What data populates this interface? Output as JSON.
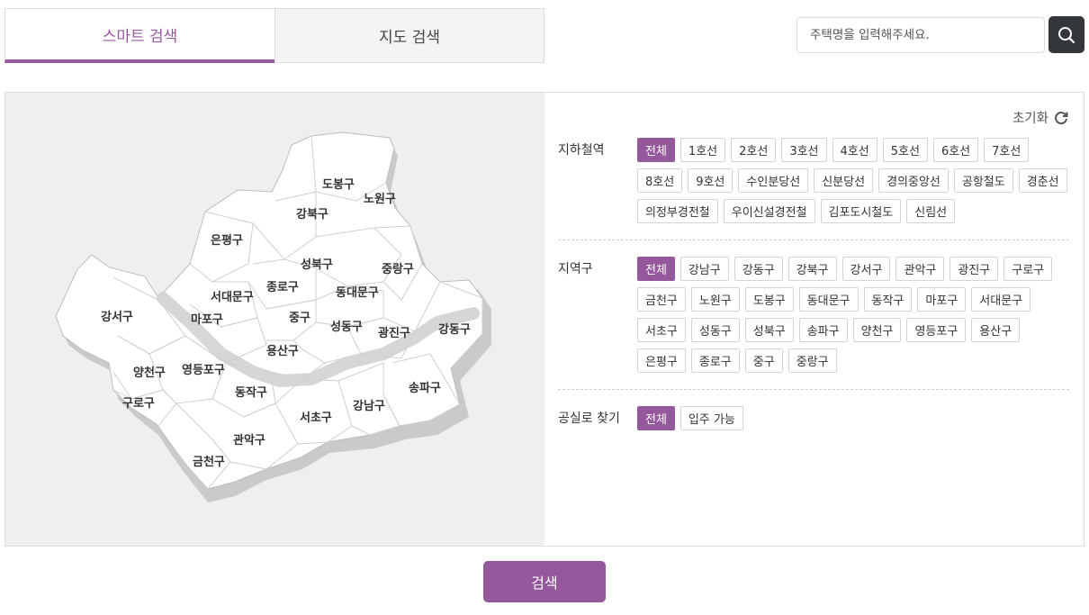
{
  "tabs": [
    {
      "label": "스마트 검색",
      "active": true
    },
    {
      "label": "지도 검색",
      "active": false
    }
  ],
  "search": {
    "placeholder": "주택명을 입력해주세요.",
    "icon": "search-icon"
  },
  "reset": {
    "label": "초기화",
    "icon": "refresh-icon"
  },
  "filters": {
    "subway": {
      "label": "지하철역",
      "options": [
        "전체",
        "1호선",
        "2호선",
        "3호선",
        "4호선",
        "5호선",
        "6호선",
        "7호선",
        "8호선",
        "9호선",
        "수인분당선",
        "신분당선",
        "경의중앙선",
        "공항철도",
        "경춘선",
        "의정부경전철",
        "우이신설경전철",
        "김포도시철도",
        "신림선"
      ],
      "selected": "전체"
    },
    "district": {
      "label": "지역구",
      "options": [
        "전체",
        "강남구",
        "강동구",
        "강북구",
        "강서구",
        "관악구",
        "광진구",
        "구로구",
        "금천구",
        "노원구",
        "도봉구",
        "동대문구",
        "동작구",
        "마포구",
        "서대문구",
        "서초구",
        "성동구",
        "성북구",
        "송파구",
        "양천구",
        "영등포구",
        "용산구",
        "은평구",
        "종로구",
        "중구",
        "중랑구"
      ],
      "selected": "전체"
    },
    "vacancy": {
      "label": "공실로 찾기",
      "options": [
        "전체",
        "입주 가능"
      ],
      "selected": "전체"
    }
  },
  "map_labels": [
    "도봉구",
    "노원구",
    "강북구",
    "은평구",
    "성북구",
    "중랑구",
    "종로구",
    "서대문구",
    "동대문구",
    "강서구",
    "마포구",
    "중구",
    "성동구",
    "광진구",
    "강동구",
    "용산구",
    "양천구",
    "영등포구",
    "동작구",
    "구로구",
    "송파구",
    "서초구",
    "강남구",
    "관악구",
    "금천구"
  ],
  "submit": {
    "label": "검색"
  },
  "colors": {
    "accent": "#96589d",
    "dark_button": "#33373c",
    "map_bg": "#efefef"
  }
}
